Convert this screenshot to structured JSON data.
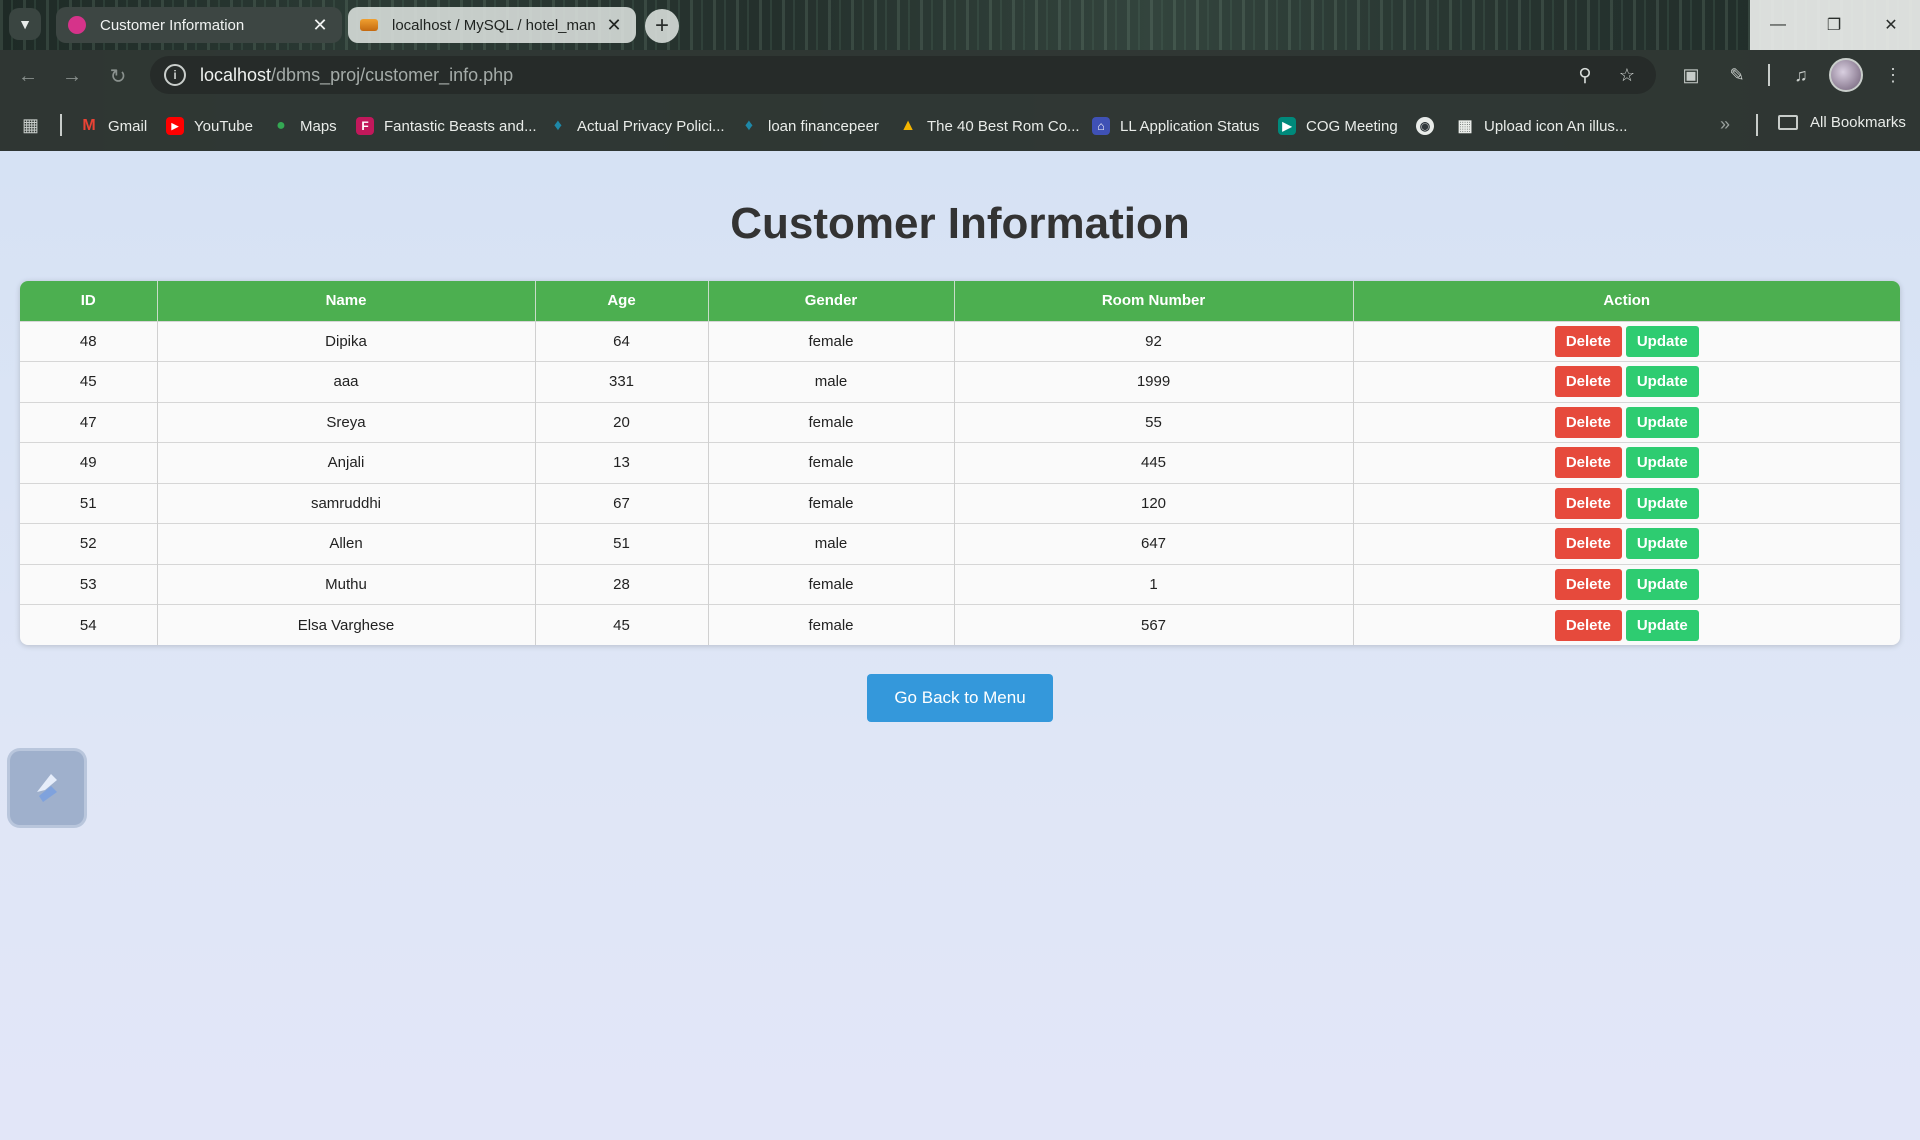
{
  "browser": {
    "tabs": [
      {
        "title": "Customer Information",
        "active": true
      },
      {
        "title": "localhost / MySQL / hotel_man",
        "active": false
      }
    ],
    "url_host": "localhost",
    "url_path": "/dbms_proj/customer_info.php",
    "bookmarks": [
      {
        "label": "Gmail",
        "icon": "gmail-icon",
        "color": "#ea4335"
      },
      {
        "label": "YouTube",
        "icon": "youtube-icon",
        "color": "#ff0000"
      },
      {
        "label": "Maps",
        "icon": "maps-icon",
        "color": "#34a853"
      },
      {
        "label": "Fantastic Beasts and...",
        "icon": "fandom-icon",
        "color": "#c2185b"
      },
      {
        "label": "Actual Privacy Polici...",
        "icon": "leaf-icon",
        "color": "#1e88a8"
      },
      {
        "label": "loan financepeer",
        "icon": "leaf-icon",
        "color": "#1e88a8"
      },
      {
        "label": "The 40 Best Rom Co...",
        "icon": "triangle-icon",
        "color": "#f4b400"
      },
      {
        "label": "LL Application Status",
        "icon": "building-icon",
        "color": "#3f51b5"
      },
      {
        "label": "COG Meeting",
        "icon": "meet-icon",
        "color": "#00897b"
      },
      {
        "label": "",
        "icon": "globe-icon",
        "color": "#c8cdca"
      },
      {
        "label": "Upload icon An illus...",
        "icon": "columns-icon",
        "color": "#e9ece9"
      }
    ],
    "all_bookmarks": "All Bookmarks"
  },
  "page": {
    "title": "Customer Information",
    "back_button": "Go Back to Menu"
  },
  "table": {
    "headers": [
      "ID",
      "Name",
      "Age",
      "Gender",
      "Room Number",
      "Action"
    ],
    "delete_label": "Delete",
    "update_label": "Update",
    "rows": [
      {
        "id": "48",
        "name": "Dipika",
        "age": "64",
        "gender": "female",
        "room": "92"
      },
      {
        "id": "45",
        "name": "aaa",
        "age": "331",
        "gender": "male",
        "room": "1999"
      },
      {
        "id": "47",
        "name": "Sreya",
        "age": "20",
        "gender": "female",
        "room": "55"
      },
      {
        "id": "49",
        "name": "Anjali",
        "age": "13",
        "gender": "female",
        "room": "445"
      },
      {
        "id": "51",
        "name": "samruddhi",
        "age": "67",
        "gender": "female",
        "room": "120"
      },
      {
        "id": "52",
        "name": "Allen",
        "age": "51",
        "gender": "male",
        "room": "647"
      },
      {
        "id": "53",
        "name": "Muthu",
        "age": "28",
        "gender": "female",
        "room": "1"
      },
      {
        "id": "54",
        "name": "Elsa Varghese",
        "age": "45",
        "gender": "female",
        "room": "567"
      }
    ]
  },
  "colors": {
    "header_green": "#4caf50",
    "delete_red": "#e64a3c",
    "update_green": "#2ecc71",
    "back_blue": "#3498db"
  }
}
